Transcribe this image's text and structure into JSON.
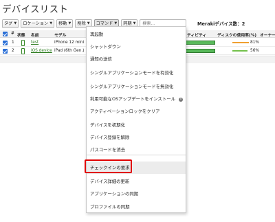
{
  "page": {
    "title": "デバイスリスト"
  },
  "toolbar": {
    "tag_label": "タグ",
    "location_label": "ロケーション",
    "move_label": "移動",
    "delete_label": "削除",
    "command_label": "コマンド",
    "sync_label": "同期",
    "search_placeholder": "検索...",
    "device_count_label": "Merakiデバイス数：2"
  },
  "table": {
    "headers": {
      "num": "#",
      "status": "状態",
      "name": "名前",
      "model": "モデル",
      "connectivity": "ティビティ",
      "disk": "ディスクの使用率(%)",
      "owner": "オーナー"
    },
    "rows": [
      {
        "num": "1",
        "name": "test",
        "model": "iPhone 12 mini",
        "disk_pct": "81%",
        "disk_color": "#f0a030"
      },
      {
        "num": "2",
        "name": "iOS device",
        "model": "iPad (6th Gen.)",
        "disk_pct": "56%",
        "disk_color": "#72c04a"
      }
    ]
  },
  "command_menu": {
    "items": [
      "再起動",
      "シャットダウン",
      "通知の送信",
      "シングルアプリケーションモードを有効化",
      "シングルアプリケーションモードを無効化",
      "利用可能なOSアップデートをインストール",
      "アクティベーションロックをクリア",
      "デバイスを初期化",
      "デバイス登録を解除",
      "パスコードを消去",
      "",
      "チェックインの要求",
      "デバイス詳細の更新",
      "アプリケーションの同期",
      "プロファイルの同期"
    ],
    "highlighted_item": "チェックインの要求",
    "info_icon_glyph": "i"
  },
  "colors": {
    "highlight_border": "#e10000",
    "link_green": "#2a7a1c",
    "connectivity_green": "#58b95a",
    "checkbox_blue": "#2b6fd6"
  }
}
